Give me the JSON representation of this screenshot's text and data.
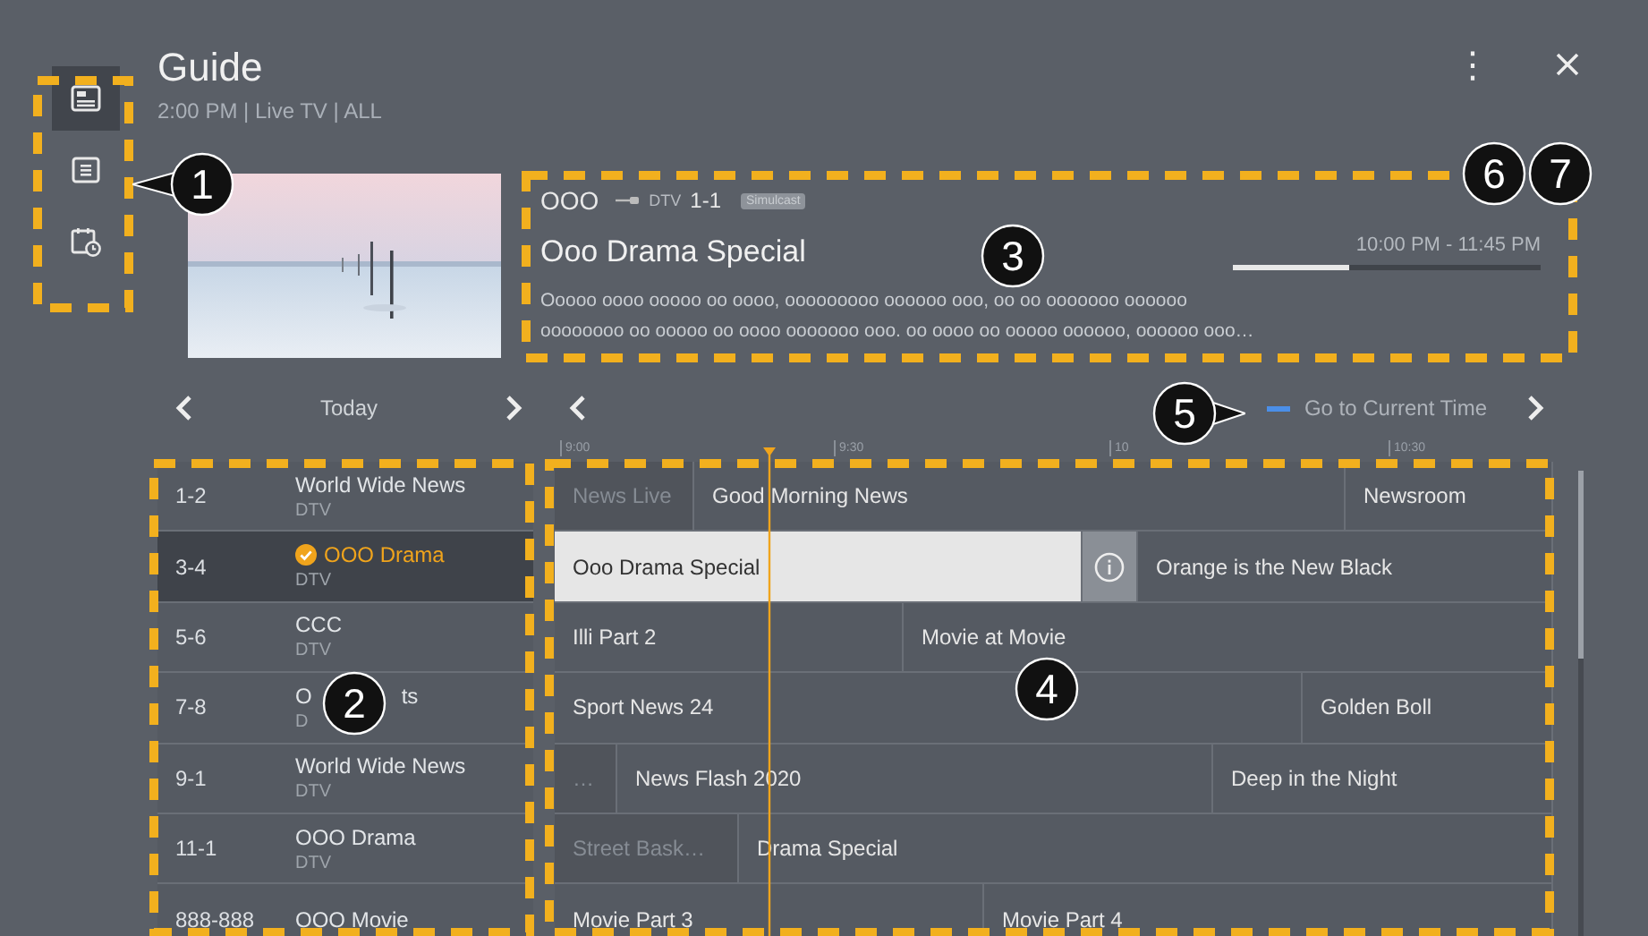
{
  "sidebar": {
    "items": [
      {
        "kind": "guide",
        "selected": true
      },
      {
        "kind": "list",
        "selected": false
      },
      {
        "kind": "schedule",
        "selected": false
      }
    ]
  },
  "header": {
    "title": "Guide",
    "subtitle": "2:00 PM | Live TV | ALL",
    "more_icon": "⋮"
  },
  "now_playing": {
    "picture": {
      "kind": "picture"
    },
    "channel_name": "OOO",
    "source": "DTV",
    "channel_number": "1-1",
    "badge": "Simulcast",
    "title": "Ooo Drama Special",
    "time": "10:00 PM - 11:45 PM",
    "level": 0.38,
    "description": [
      "Ooooo oooo ooooo oo oooo, ooooooooo oooooo ooo, oo oo ooooooo oooooo",
      "oooooooo oo ooooo oo oooo ooooooo ooo. oo oooo oo ooooo oooooo, oooooo ooo…"
    ]
  },
  "date_nav": {
    "label": "Today"
  },
  "time_nav": {
    "label": "Go to Current Time"
  },
  "timeline": [
    "9:00",
    "9:30",
    "10",
    "10:30"
  ],
  "channels": [
    {
      "number": "1-2",
      "name": "World Wide News",
      "type": "DTV",
      "selected": false,
      "programs": [
        {
          "kind": "program",
          "title": "News Live",
          "past": true,
          "selected": false
        },
        {
          "kind": "program",
          "title": "Good Morning News",
          "past": false,
          "selected": false
        },
        {
          "kind": "program",
          "title": "Newsroom",
          "past": false,
          "selected": false
        }
      ]
    },
    {
      "number": "3-4",
      "name": "OOO Drama",
      "type": "DTV",
      "selected": true,
      "programs": [
        {
          "kind": "program",
          "title": "Ooo Drama Special",
          "past": false,
          "selected": true
        },
        {
          "kind": "info"
        },
        {
          "kind": "program",
          "title": "Orange is the New Black",
          "past": false,
          "selected": false
        }
      ]
    },
    {
      "number": "5-6",
      "name": "CCC",
      "type": "DTV",
      "selected": false,
      "programs": [
        {
          "kind": "program",
          "title": "Illi Part 2",
          "past": false,
          "selected": false
        },
        {
          "kind": "program",
          "title": "Movie at Movie",
          "past": false,
          "selected": false
        }
      ]
    },
    {
      "number": "7-8",
      "name": "O",
      "name_tail": "ts",
      "type": "D",
      "selected": false,
      "programs": [
        {
          "kind": "program",
          "title": "Sport News 24",
          "past": false,
          "selected": false
        },
        {
          "kind": "program",
          "title": "Golden Boll",
          "past": false,
          "selected": false
        }
      ]
    },
    {
      "number": "9-1",
      "name": "World Wide News",
      "type": "DTV",
      "selected": false,
      "programs": [
        {
          "kind": "program",
          "title": "…",
          "past": true,
          "selected": false
        },
        {
          "kind": "program",
          "title": "News Flash 2020",
          "past": false,
          "selected": false
        },
        {
          "kind": "program",
          "title": "Deep in the Night",
          "past": false,
          "selected": false
        }
      ]
    },
    {
      "number": "11-1",
      "name": "OOO Drama",
      "type": "DTV",
      "selected": false,
      "programs": [
        {
          "kind": "program",
          "title": "Street Bask…",
          "past": true,
          "selected": false
        },
        {
          "kind": "program",
          "title": "Drama Special",
          "past": false,
          "selected": false
        }
      ]
    },
    {
      "number": "888-888",
      "name": "OOO Movie",
      "selected": false,
      "programs": [
        {
          "kind": "program",
          "title": "Movie Part 3",
          "past": false,
          "selected": false
        },
        {
          "kind": "program",
          "title": "Movie Part 4",
          "past": false,
          "selected": false
        }
      ]
    }
  ],
  "annotations": [
    {
      "number": "1"
    },
    {
      "number": "2"
    },
    {
      "number": "3"
    },
    {
      "number": "4"
    },
    {
      "number": "5"
    },
    {
      "number": "6"
    },
    {
      "number": "7"
    }
  ]
}
